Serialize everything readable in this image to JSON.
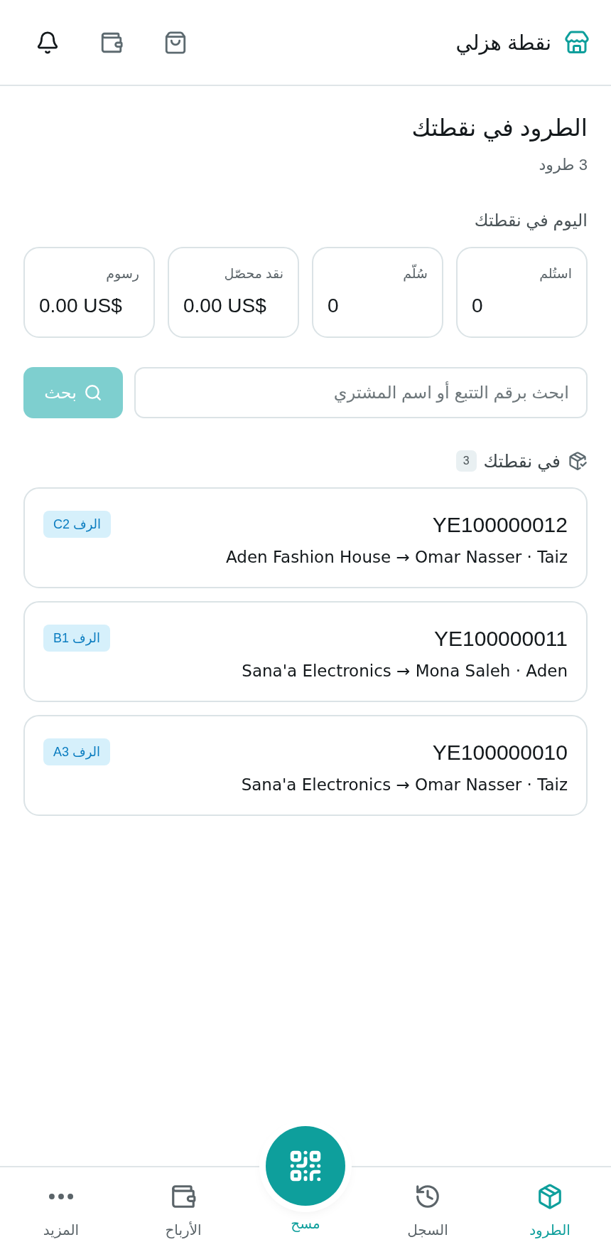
{
  "header": {
    "title": "نقطة هزلي"
  },
  "page": {
    "title": "الطرود في نقطتك",
    "subtitle": "3 طرود"
  },
  "today": {
    "heading": "اليوم في نقطتك",
    "stats": [
      {
        "label": "استُلم",
        "value": "0"
      },
      {
        "label": "سُلّم",
        "value": "0"
      },
      {
        "label": "نقد محصّل",
        "value": "0.00 US$"
      },
      {
        "label": "رسوم",
        "value": "0.00 US$"
      }
    ]
  },
  "search": {
    "placeholder": "ابحث برقم التتبع أو اسم المشتري",
    "button": "بحث"
  },
  "parcels": {
    "heading": "في نقطتك",
    "count": "3",
    "items": [
      {
        "tracking": "YE100000012",
        "route": "Aden Fashion House → Omar Nasser · Taiz",
        "shelf": "الرف C2"
      },
      {
        "tracking": "YE100000011",
        "route": "Sana'a Electronics → Mona Saleh · Aden",
        "shelf": "الرف B1"
      },
      {
        "tracking": "YE100000010",
        "route": "Sana'a Electronics → Omar Nasser · Taiz",
        "shelf": "الرف A3"
      }
    ]
  },
  "nav": {
    "items": [
      {
        "label": "الطرود",
        "kind": "parcels",
        "selected": true
      },
      {
        "label": "السجل",
        "kind": "history",
        "selected": false
      },
      {
        "label": "مسح",
        "kind": "scan",
        "selected": false
      },
      {
        "label": "الأرباح",
        "kind": "earnings",
        "selected": false
      },
      {
        "label": "المزيد",
        "kind": "more",
        "selected": false
      }
    ]
  }
}
